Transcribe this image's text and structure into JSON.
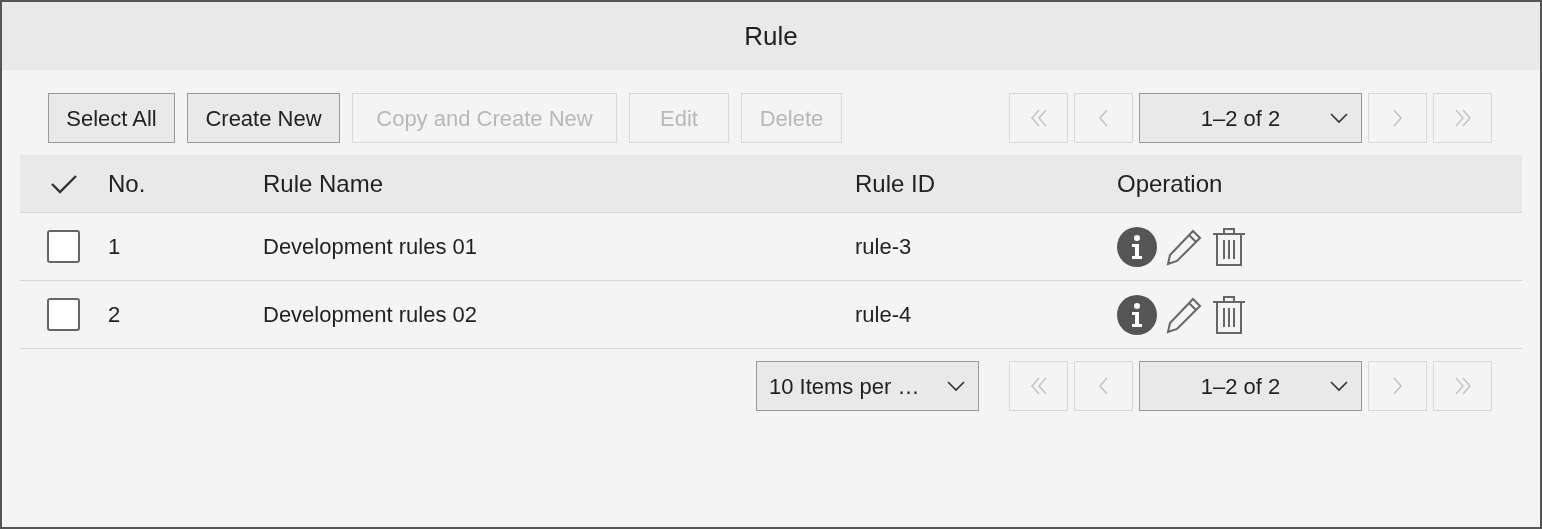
{
  "window": {
    "title": "Rule"
  },
  "toolbar": {
    "buttons": [
      {
        "label": "Select All",
        "disabled": false
      },
      {
        "label": "Create New",
        "disabled": false
      },
      {
        "label": "Copy and Create New",
        "disabled": true
      },
      {
        "label": "Edit",
        "disabled": true
      },
      {
        "label": "Delete",
        "disabled": true
      }
    ]
  },
  "pagination_top": {
    "first_disabled": true,
    "prev_disabled": true,
    "page": "1–2 of 2",
    "next_disabled": true,
    "last_disabled": true
  },
  "table": {
    "columns": [
      "No.",
      "Rule Name",
      "Rule ID",
      "Operation"
    ],
    "rows": [
      {
        "checked": false,
        "cells": [
          "1",
          "Development rules 01",
          "rule-3"
        ]
      },
      {
        "checked": false,
        "cells": [
          "2",
          "Development rules 02",
          "rule-4"
        ]
      }
    ]
  },
  "pagination_bottom": {
    "items_per_page": "10 Items per …",
    "first_disabled": true,
    "prev_disabled": true,
    "page": "1–2 of 2",
    "next_disabled": true,
    "last_disabled": true
  }
}
